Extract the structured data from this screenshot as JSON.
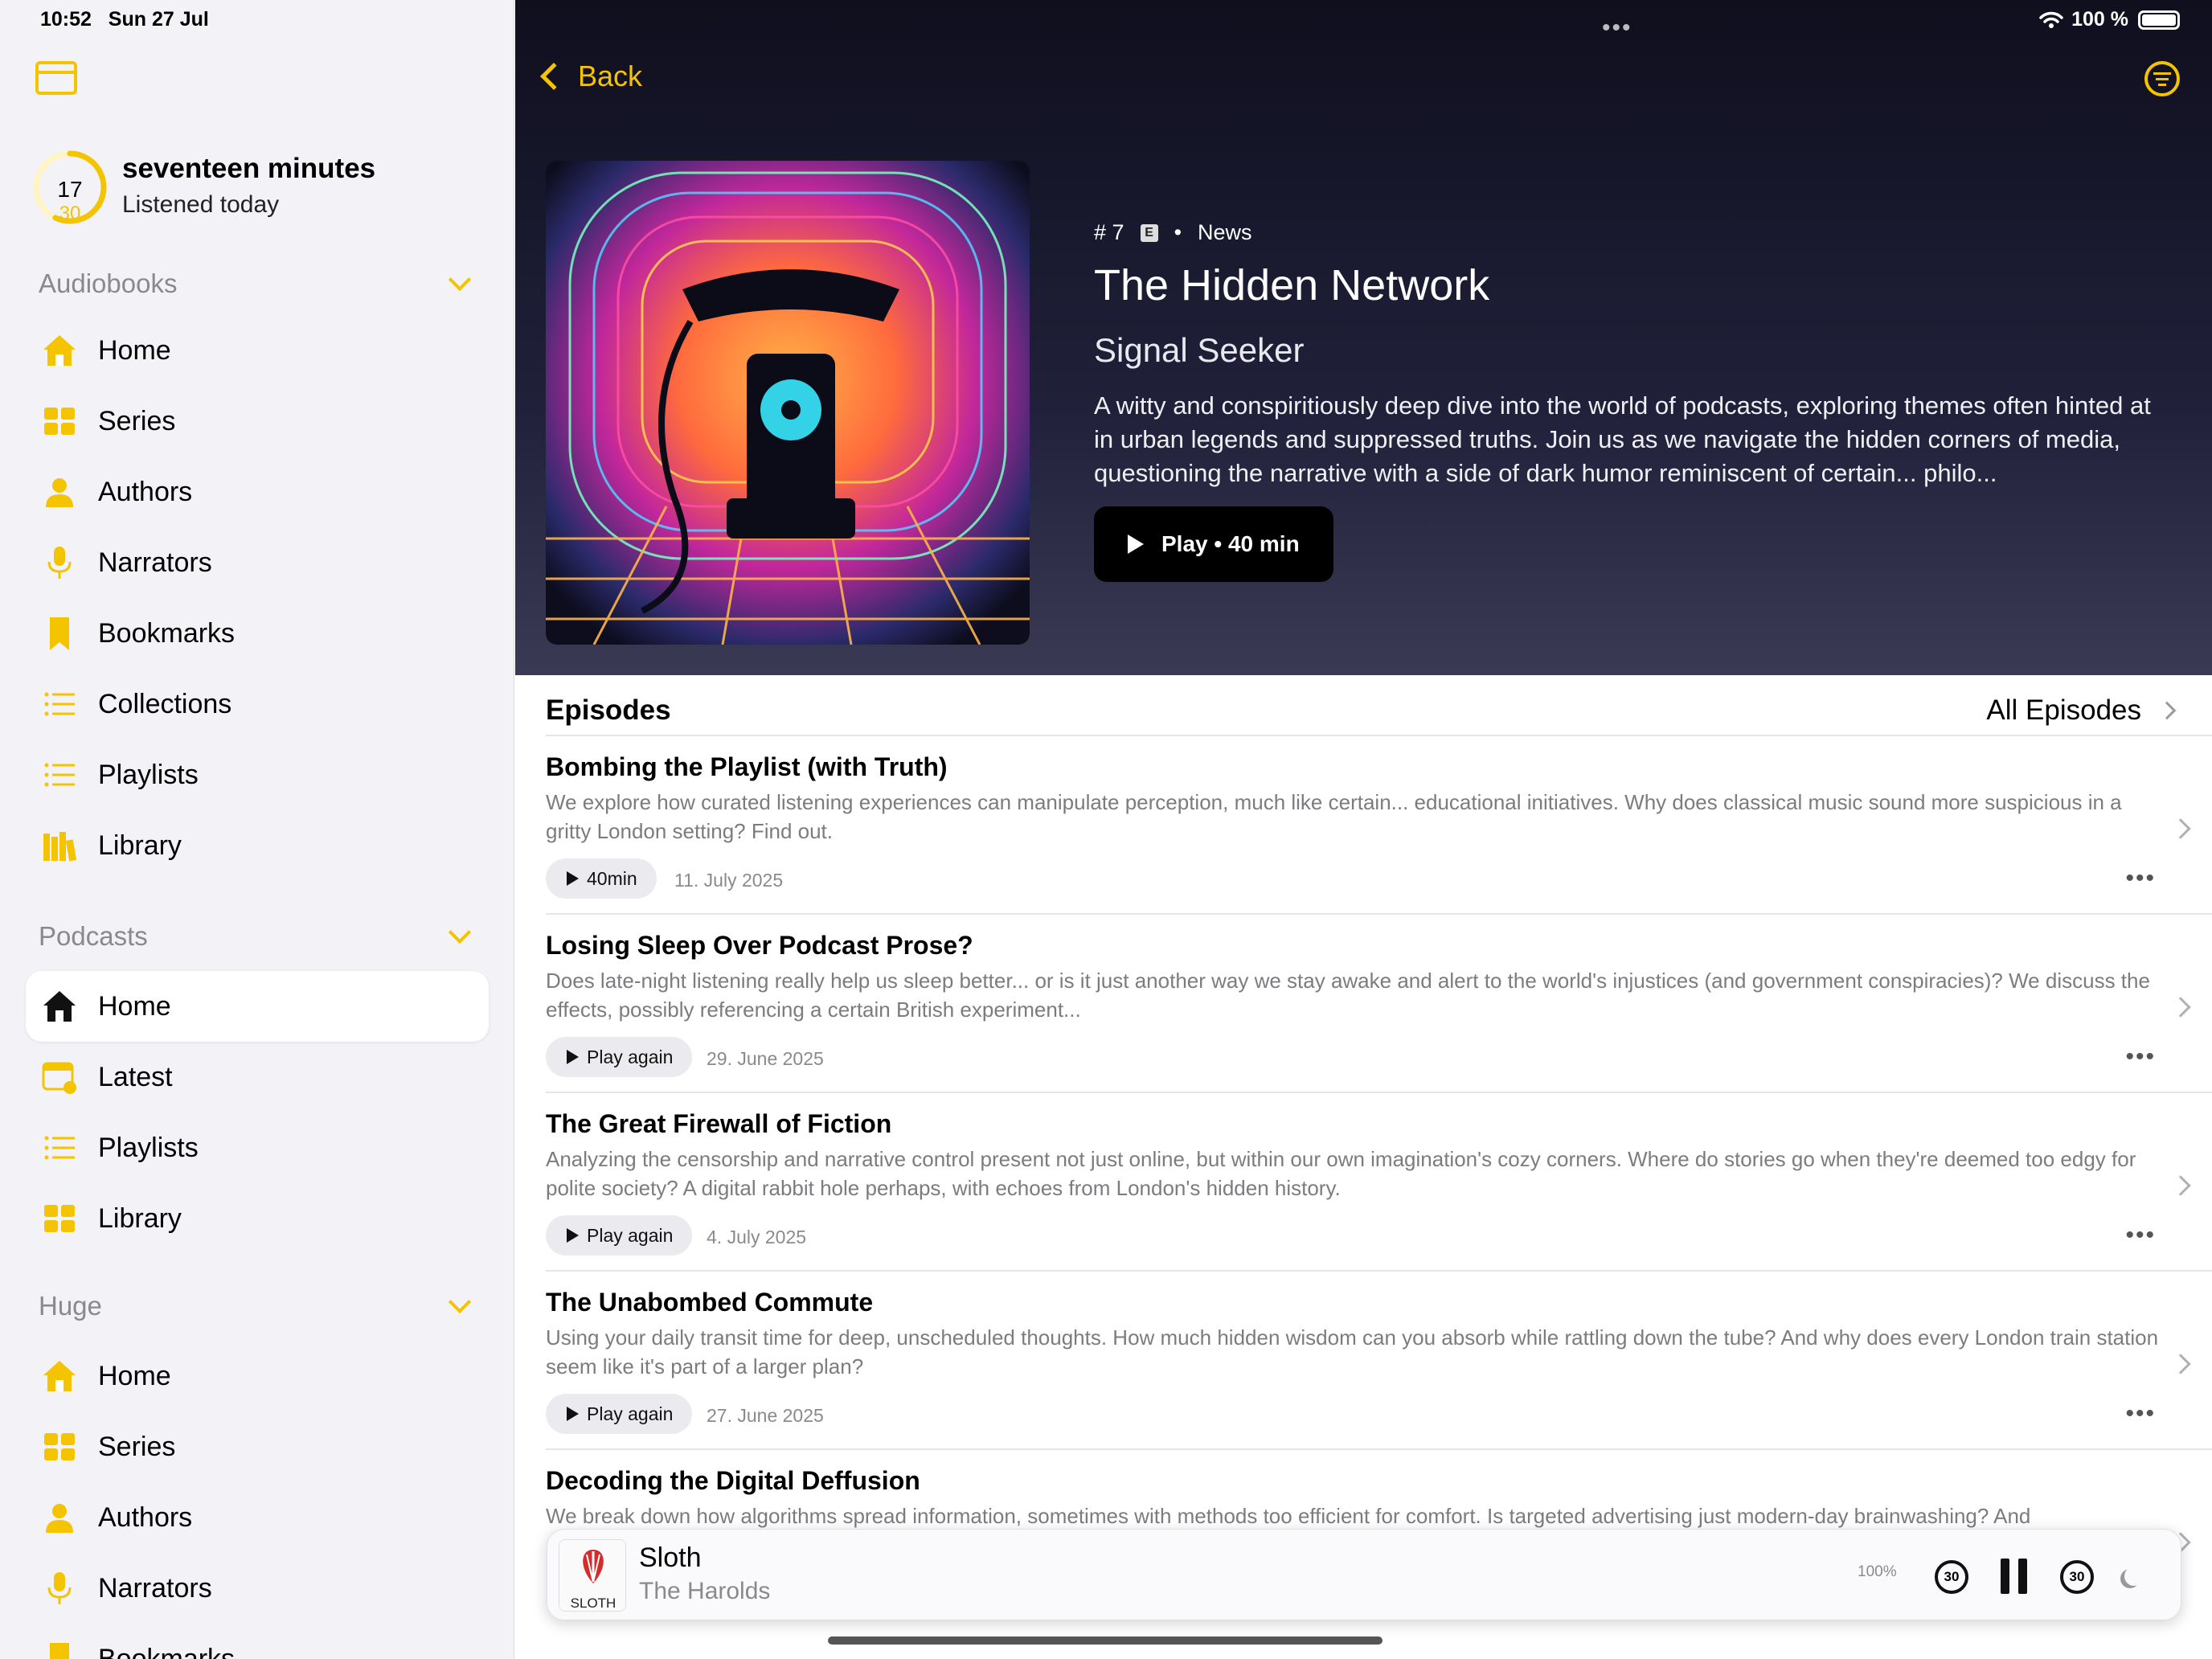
{
  "status": {
    "time": "10:52",
    "date": "Sun 27 Jul",
    "battery": "100 %"
  },
  "listening": {
    "minutes": "17",
    "goal": "30",
    "title": "seventeen minutes",
    "subtitle": "Listened today",
    "progress": 0.57
  },
  "sidebar": {
    "sections": [
      {
        "title": "Audiobooks",
        "items": [
          {
            "label": "Home",
            "icon": "house-icon"
          },
          {
            "label": "Series",
            "icon": "grid-icon"
          },
          {
            "label": "Authors",
            "icon": "person-icon"
          },
          {
            "label": "Narrators",
            "icon": "microphone-icon"
          },
          {
            "label": "Bookmarks",
            "icon": "bookmark-icon"
          },
          {
            "label": "Collections",
            "icon": "list-icon"
          },
          {
            "label": "Playlists",
            "icon": "list-icon"
          },
          {
            "label": "Library",
            "icon": "books-icon"
          }
        ]
      },
      {
        "title": "Podcasts",
        "items": [
          {
            "label": "Home",
            "icon": "house-icon",
            "active": true
          },
          {
            "label": "Latest",
            "icon": "calendar-icon"
          },
          {
            "label": "Playlists",
            "icon": "list-icon"
          },
          {
            "label": "Library",
            "icon": "grid-icon"
          }
        ]
      },
      {
        "title": "Huge",
        "items": [
          {
            "label": "Home",
            "icon": "house-icon"
          },
          {
            "label": "Series",
            "icon": "grid-icon"
          },
          {
            "label": "Authors",
            "icon": "person-icon"
          },
          {
            "label": "Narrators",
            "icon": "microphone-icon"
          },
          {
            "label": "Bookmarks",
            "icon": "bookmark-icon"
          }
        ]
      }
    ]
  },
  "hero": {
    "back_label": "Back",
    "episode_number": "7",
    "explicit_badge": "E",
    "category": "News",
    "title": "The Hidden Network",
    "show": "Signal Seeker",
    "description": "A witty and conspiritiously deep dive into the world of podcasts, exploring themes often hinted at in urban legends and suppressed truths. Join us as we navigate the hidden corners of media, questioning the narrative with a side of dark humor reminiscent of certain... philo...",
    "play_label": "Play",
    "play_duration": "40 min"
  },
  "episodes": {
    "header": "Episodes",
    "all_label": "All Episodes",
    "items": [
      {
        "title": "Bombing the Playlist (with Truth)",
        "description": "We explore how curated listening experiences can manipulate perception, much like certain... educational initiatives. Why does classical music sound more suspicious in a gritty London setting? Find out.",
        "action": "40min",
        "date": "11. July 2025"
      },
      {
        "title": "Losing Sleep Over Podcast Prose?",
        "description": "Does late-night listening really help us sleep better... or is it just another way we stay awake and alert to the world's injustices (and government conspiracies)? We discuss the effects, possibly referencing a certain British experiment...",
        "action": "Play again",
        "date": "29. June 2025"
      },
      {
        "title": "The Great Firewall of Fiction",
        "description": "Analyzing the censorship and narrative control present not just online, but within our own imagination's cozy corners. Where do stories go when they're deemed too edgy for polite society? A digital rabbit hole perhaps, with echoes from London's hidden history.",
        "action": "Play again",
        "date": "4. July 2025"
      },
      {
        "title": "The Unabombed Commute",
        "description": "Using your daily transit time for deep, unscheduled thoughts. How much hidden wisdom can you absorb while rattling down the tube? And why does every London train station seem like it's part of a larger plan?",
        "action": "Play again",
        "date": "27. June 2025"
      },
      {
        "title": "Decoding the Digital Deffusion",
        "description": "We break down how algorithms spread information, sometimes with methods too efficient for comfort. Is targeted advertising just modern-day brainwashing? And",
        "action": "",
        "date": ""
      }
    ]
  },
  "player": {
    "title": "Sloth",
    "artist": "The Harolds",
    "artwork_text": "SLOTH",
    "rate": "100%",
    "skip_back": "30",
    "skip_forward": "30"
  },
  "colors": {
    "accent": "#f5c400",
    "hero_bg": "#1a1a30"
  }
}
